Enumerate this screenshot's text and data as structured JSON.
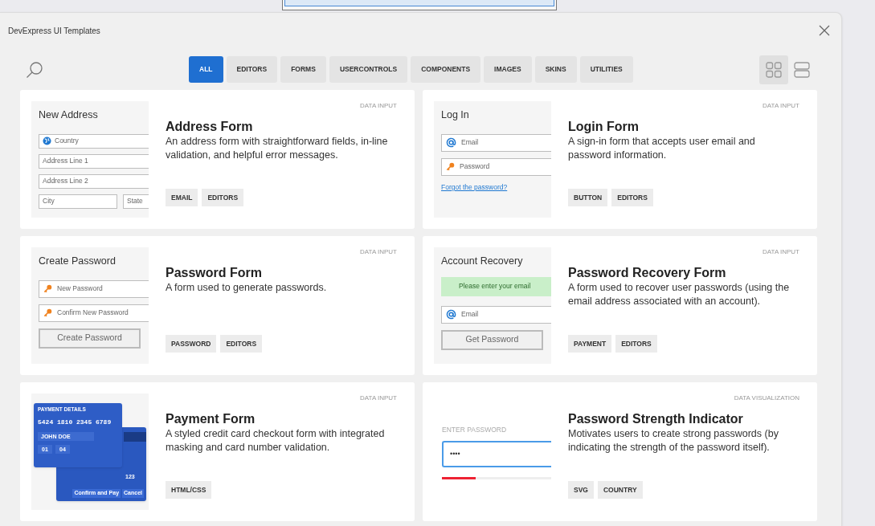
{
  "window": {
    "title": "DevExpress UI Templates"
  },
  "tabs": [
    {
      "label": "ALL",
      "selected": true
    },
    {
      "label": "EDITORS",
      "selected": false
    },
    {
      "label": "FORMS",
      "selected": false
    },
    {
      "label": "USERCONTROLS",
      "selected": false
    },
    {
      "label": "COMPONENTS",
      "selected": false
    },
    {
      "label": "IMAGES",
      "selected": false
    },
    {
      "label": "SKINS",
      "selected": false
    },
    {
      "label": "UTILITIES",
      "selected": false
    }
  ],
  "view_modes": [
    {
      "kind": "grid",
      "selected": true
    },
    {
      "kind": "list",
      "selected": false
    }
  ],
  "cards": [
    {
      "title": "Address Form",
      "description": "An address form with straightforward fields, in-line validation, and helpful error messages.",
      "category": "DATA INPUT",
      "tags": [
        "EMAIL",
        "EDITORS"
      ],
      "preview": {
        "kind": "form",
        "heading": "New Address",
        "items": [
          {
            "kind": "globe_field",
            "text": "Country"
          },
          {
            "kind": "field",
            "text": "Address Line 1"
          },
          {
            "kind": "field",
            "text": "Address Line 2"
          },
          {
            "kind": "pair",
            "texts": [
              "City",
              "State"
            ]
          }
        ]
      }
    },
    {
      "title": "Login Form",
      "description": "A sign-in form that accepts user email and password information.",
      "category": "DATA INPUT",
      "tags": [
        "BUTTON",
        "EDITORS"
      ],
      "preview": {
        "kind": "form",
        "heading": "Log In",
        "items": [
          {
            "kind": "email_field",
            "text": "Email"
          },
          {
            "kind": "password_field",
            "text": "Password"
          },
          {
            "kind": "link",
            "text": "Forgot the password?"
          }
        ]
      }
    },
    {
      "title": "Password Form",
      "description": "A form used to generate passwords.",
      "category": "DATA INPUT",
      "tags": [
        "PASSWORD",
        "EDITORS"
      ],
      "preview": {
        "kind": "form",
        "heading": "Create Password",
        "items": [
          {
            "kind": "password_field",
            "text": "New Password"
          },
          {
            "kind": "password_field",
            "text": "Confirm New Password"
          },
          {
            "kind": "button",
            "text": "Create Password"
          }
        ]
      }
    },
    {
      "title": "Password Recovery Form",
      "description": "A form used to recover user passwords (using the email address associated with an account).",
      "category": "DATA INPUT",
      "tags": [
        "PAYMENT",
        "EDITORS"
      ],
      "preview": {
        "kind": "form",
        "heading": "Account Recovery",
        "items": [
          {
            "kind": "banner",
            "text": "Please enter your email"
          },
          {
            "kind": "email_field",
            "text": "Email"
          },
          {
            "kind": "button",
            "text": "Get Password"
          }
        ]
      }
    },
    {
      "title": "Payment Form",
      "description": "A styled credit card checkout form with integrated masking and card number validation.",
      "category": "DATA INPUT",
      "tags": [
        "HTML/CSS"
      ],
      "preview": {
        "kind": "payment",
        "heading": "PAYMENT DETAILS",
        "number": "5424 1810 2345 6789",
        "name": "JOHN DOE",
        "month": "01",
        "year": "04",
        "cvv": "123",
        "buttons": [
          "Confirm and Pay",
          "Cancel"
        ]
      }
    },
    {
      "title": "Password Strength Indicator",
      "description": "Motivates users to create strong passwords (by indicating the strength of the password itself).",
      "category": "DATA VISUALIZATION",
      "tags": [
        "SVG",
        "COUNTRY"
      ],
      "preview": {
        "kind": "strength",
        "label": "ENTER PASSWORD",
        "value": "••••",
        "level": 0.31
      }
    }
  ]
}
